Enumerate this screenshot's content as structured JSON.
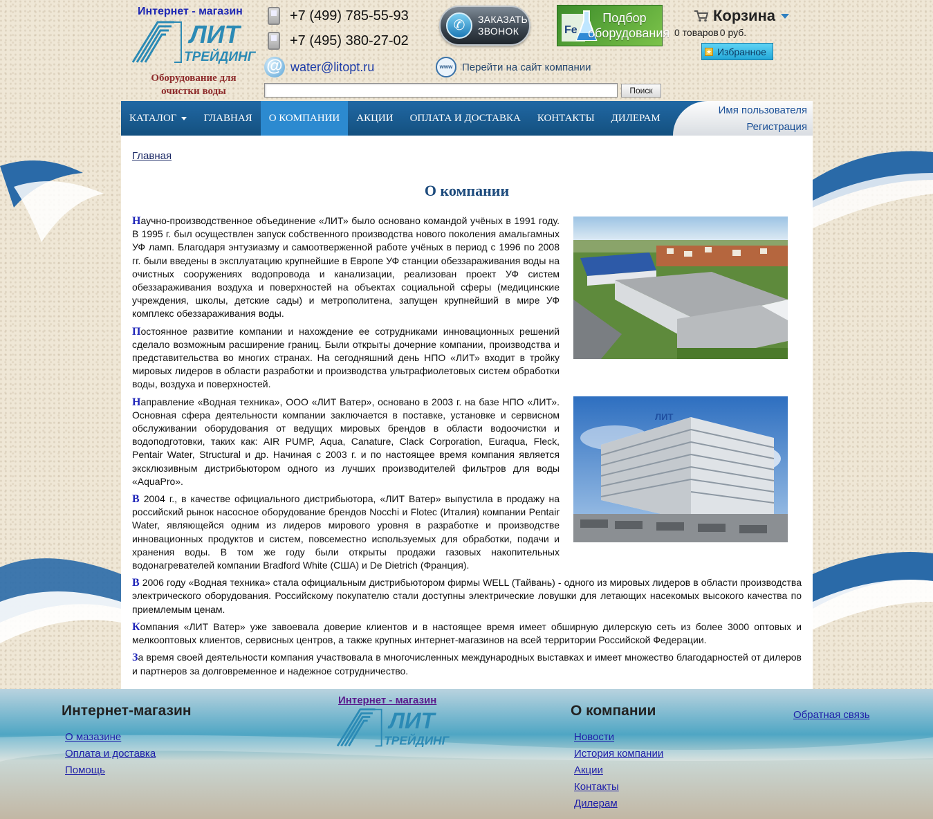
{
  "header": {
    "shop_label": "Интернет - магазин",
    "brand_line1": "ЛИТ",
    "brand_line2": "ТРЕЙДИНГ",
    "tagline_line1": "Оборудование для",
    "tagline_line2": "очистки воды",
    "phone1": "+7 (499) 785-55-93",
    "phone2": "+7 (495) 380-27-02",
    "email": "water@litopt.ru",
    "callback_line1": "Заказать",
    "callback_line2": "звонок",
    "select_line1": "Подбор",
    "select_line2": "оборудования",
    "select_symbol": "Fe",
    "company_site_link": "Перейти на сайт компании",
    "www_label": "www",
    "cart_title": "Корзина",
    "cart_items": "0 товаров",
    "cart_sum": "0 руб.",
    "favorites": "Избранное",
    "search_placeholder": "",
    "search_button": "Поиск"
  },
  "nav": {
    "items": [
      {
        "label": "Каталог"
      },
      {
        "label": "Главная"
      },
      {
        "label": "О компании"
      },
      {
        "label": "Акции"
      },
      {
        "label": "Оплата и доставка"
      },
      {
        "label": "Контакты"
      },
      {
        "label": "Дилерам"
      }
    ],
    "username": "Имя пользователя",
    "register": "Регистрация"
  },
  "main": {
    "breadcrumb": "Главная",
    "title": "О компании",
    "paragraphs": [
      {
        "first": "Н",
        "rest": "аучно-производственное объединение «ЛИТ» было основано командой учёных в 1991 году. В 1995 г. был осуществлен запуск собственного производства нового поколения амальгамных УФ ламп. Благодаря энтузиазму и самоотверженной работе учёных в период с 1996 по 2008 гг. были введены в эксплуатацию крупнейшие в Европе УФ станции обеззараживания воды на очистных сооружениях водопровода и канализации, реализован проект УФ систем обеззараживания воздуха и поверхностей на объектах социальной сферы (медицинские учреждения, школы, детские сады) и метрополитена, запущен крупнейший в мире УФ комплекс обеззараживания воды."
      },
      {
        "first": "П",
        "rest": "остоянное развитие компании и нахождение ее сотрудниками инновационных решений сделало возможным расширение границ. Были открыты дочерние компании, производства и представительства во многих странах. На сегодняшний день НПО «ЛИТ» входит в тройку мировых лидеров в области разработки и производства ультрафиолетовых систем обработки воды, воздуха и поверхностей."
      },
      {
        "first": "Н",
        "rest": "аправление «Водная техника», ООО «ЛИТ Ватер», основано в 2003 г. на базе НПО «ЛИТ». Основная сфера деятельности компании заключается в поставке, установке и сервисном обслуживании оборудования от ведущих мировых брендов в области водоочистки и водоподготовки, таких как: AIR PUMP, Aqua, Canature, Clack Corporation, Euraqua, Fleck, Pentair Water, Structural и др. Начиная с 2003 г. и по настоящее время компания является эксклюзивным дистрибьютором одного из лучших производителей фильтров для воды «AquaPro»."
      },
      {
        "first": "В",
        "rest": " 2004 г., в качестве официального дистрибьютора, «ЛИТ Ватер» выпустила в продажу на российский рынок насосное оборудование брендов Nocchi и Flotec (Италия) компании Pentair Water, являющейся одним из лидеров мирового уровня в разработке и производстве инновационных продуктов и систем, повсеместно используемых для обработки, подачи и хранения воды. В том же году были открыты продажи газовых накопительных водонагревателей компании Bradford White (США) и De Dietrich (Франция)."
      },
      {
        "first": "В",
        "rest": " 2006 году «Водная техника» стала официальным дистрибьютором фирмы WELL (Тайвань) - одного из мировых лидеров в области производства электрического оборудования. Российскому покупателю стали доступны электрические ловушки для летающих насекомых высокого качества по приемлемым ценам."
      },
      {
        "first": "К",
        "rest": "омпания «ЛИТ Ватер» уже завоевала доверие клиентов и в настоящее время имеет обширную дилерскую сеть из более 3000 оптовых и мелкооптовых клиентов, сервисных центров, а также крупных интернет-магазинов на всей территории Российской Федерации."
      },
      {
        "first": "З",
        "rest": "а время своей деятельности компания участвовала в многочисленных международных выставках и имеет множество благодарностей от дилеров и партнеров за долговременное и надежное сотрудничество."
      }
    ],
    "photo2_sign": "ЛИТ"
  },
  "footer": {
    "col1_title": "Интернет-магазин",
    "col1_links": [
      "О мазазине",
      "Оплата и доставка",
      "Помощь"
    ],
    "logo_text": "Интернет - магазин",
    "col2_title": "О компании",
    "col2_links": [
      "Новости",
      "История компании",
      "Акции",
      "Контакты",
      "Дилерам"
    ],
    "feedback": "Обратная связь"
  },
  "colors": {
    "nav_bg": "#1a5c94",
    "nav_active": "#2c8ad0",
    "title": "#1c4a7c",
    "drop_cap": "#1f25b8",
    "brand_logo": "#2b8ab5"
  }
}
